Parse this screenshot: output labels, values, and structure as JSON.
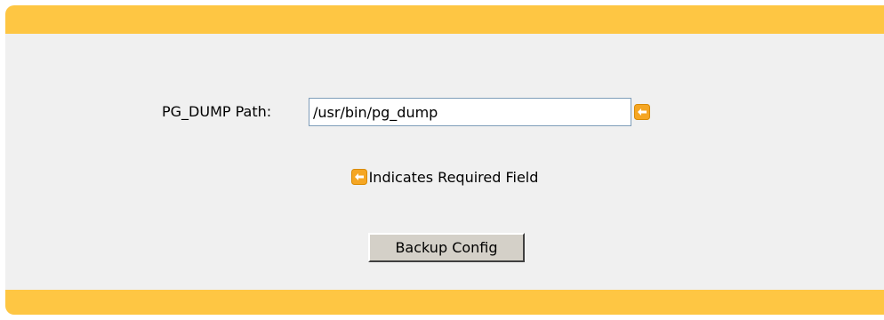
{
  "colors": {
    "banner": "#fec643",
    "panel_background": "#f0f0f0",
    "required_icon": "#f5a623"
  },
  "form": {
    "pg_dump_label": "PG_DUMP Path:",
    "pg_dump_value": "/usr/bin/pg_dump",
    "required_icon": "required-field-arrow-icon"
  },
  "legend": {
    "text": "Indicates Required Field"
  },
  "actions": {
    "backup_label": "Backup Config"
  }
}
